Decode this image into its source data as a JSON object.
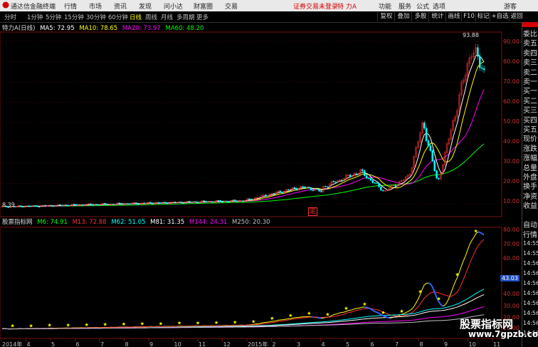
{
  "app": {
    "logo_text": "通达信金融终端",
    "menu": [
      "行情",
      "市场",
      "资讯",
      "发现",
      "问小达",
      "财富圈",
      "交易"
    ],
    "login_status": "证券交易未登录",
    "stock_name": "特 力A",
    "right_menu": [
      "功能",
      "服务",
      "公式",
      "选项"
    ],
    "user": "游客"
  },
  "toolbar": {
    "timeframes": [
      "分时",
      "1分钟",
      "5分钟",
      "15分钟",
      "30分钟",
      "60分钟",
      "日线",
      "周线",
      "月线",
      "多周期",
      "更多"
    ],
    "active_timeframe": "日线",
    "buttons": [
      "复权",
      "叠加",
      "多股",
      "统计",
      "画线",
      "F10",
      "标记",
      "+自选",
      "返回"
    ]
  },
  "kline": {
    "title": "特力A(日线)",
    "ma": [
      {
        "label": "MA5: 72.95",
        "color": "#ffffff"
      },
      {
        "label": "MA10: 78.65",
        "color": "#ffff00"
      },
      {
        "label": "MA20: 73.97",
        "color": "#ff00ff"
      },
      {
        "label": "MA60: 48.20",
        "color": "#00ff00"
      }
    ],
    "high_marker": "93.88",
    "low_marker": "8.39",
    "event_tag": "定",
    "y_ticks": [
      "90.00",
      "80.00",
      "70.00",
      "60.00",
      "50.00",
      "40.00",
      "30.00",
      "20.00",
      "10.00"
    ]
  },
  "indicator": {
    "name": "股票指标网",
    "lines": [
      {
        "label": "M6: 74.91",
        "color": "#00ff00"
      },
      {
        "label": "M13: 72.88",
        "color": "#ff3030"
      },
      {
        "label": "M62: 51.05",
        "color": "#00ffff"
      },
      {
        "label": "M81: 31.35",
        "color": "#ffffff"
      },
      {
        "label": "M144: 24.31",
        "color": "#ff00ff"
      },
      {
        "label": "M250: 20.30",
        "color": "#c0c0c0"
      }
    ],
    "y_ticks": [
      "80.00",
      "70.00",
      "60.00",
      "50.00",
      "40.00",
      "30.00",
      "20.00",
      "10.00"
    ],
    "current_value": "43.03"
  },
  "x_axis": {
    "labels": [
      "2014年",
      "4",
      "5",
      "6",
      "7",
      "8",
      "9",
      "10",
      "11",
      "12",
      "2015年",
      "2",
      "3",
      "4",
      "5",
      "6",
      "7",
      "8",
      "9",
      "10",
      "11"
    ]
  },
  "right_panel": {
    "labels": [
      "委比",
      "卖五",
      "卖四",
      "卖三",
      "卖二",
      "卖一",
      "买一",
      "买二",
      "买三",
      "买四",
      "买五",
      "现价",
      "涨跌",
      "涨幅",
      "总量",
      "外盘",
      "换手",
      "净资",
      "收益"
    ],
    "tabs": [
      "自动",
      "行情"
    ],
    "times": [
      "14:55",
      "14:55",
      "14:56",
      "14:56",
      "14:56",
      "14:56",
      "14:56",
      "14:56",
      "14:56",
      "14:56"
    ]
  },
  "watermark": {
    "line1": "股票指标网",
    "line2": "www.7gpzb.com"
  },
  "colors": {
    "up": "#ff3030",
    "down": "#00ffff",
    "ma5": "#ffffff",
    "ma10": "#ffff00",
    "ma20": "#ff00ff",
    "ma60": "#00ff00",
    "axis": "#c33333",
    "accent": "#d40000"
  }
}
